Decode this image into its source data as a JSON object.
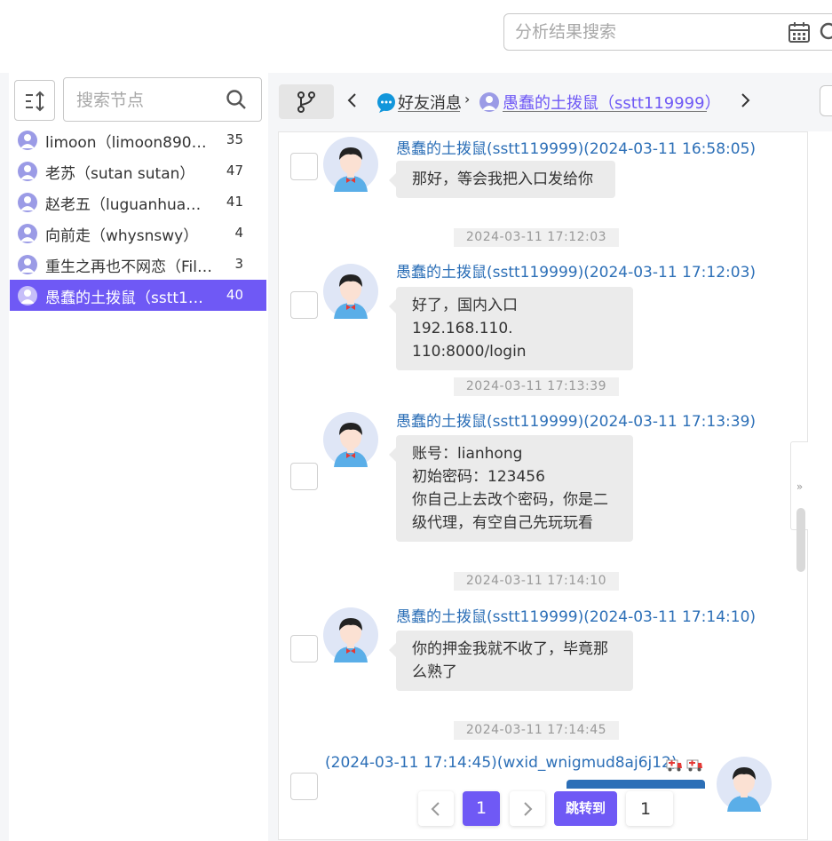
{
  "top_search": {
    "placeholder": "分析结果搜索"
  },
  "sidebar": {
    "search_placeholder": "搜索节点",
    "friends": [
      {
        "name": "limoon（limoon890…",
        "count": "35"
      },
      {
        "name": "老苏（sutan sutan）",
        "count": "47"
      },
      {
        "name": "赵老五（luguanhua…",
        "count": "41"
      },
      {
        "name": "向前走（whysnswy）",
        "count": "4"
      },
      {
        "name": "重生之再也不网恋（Fil…",
        "count": "3"
      },
      {
        "name": "愚蠢的土拨鼠（sstt1…",
        "count": "40",
        "active": true
      }
    ]
  },
  "breadcrumb": {
    "item1": "好友消息",
    "separator": "›",
    "item2": "愚蠢的土拨鼠（sstt119999）"
  },
  "messages": [
    {
      "meta": "愚蠢的土拨鼠(sstt119999)(2024-03-11 16:58:05)",
      "lines": [
        "那好，等会我把入口发给你"
      ]
    },
    {
      "timestamp": "2024-03-11 17:12:03",
      "meta": "愚蠢的土拨鼠(sstt119999)(2024-03-11 17:12:03)",
      "lines": [
        "好了，国内入口192.168.110.",
        "110:8000/login"
      ]
    },
    {
      "timestamp": "2024-03-11 17:13:39",
      "meta": "愚蠢的土拨鼠(sstt119999)(2024-03-11 17:13:39)",
      "lines": [
        "账号：lianhong",
        "初始密码：123456",
        "你自己上去改个密码，你是二",
        "级代理，有空自己先玩玩看"
      ]
    },
    {
      "timestamp": "2024-03-11 17:14:10",
      "meta": "愚蠢的土拨鼠(sstt119999)(2024-03-11 17:14:10)",
      "lines": [
        "你的押金我就不收了，毕竟那",
        "么熟了"
      ]
    },
    {
      "timestamp": "2024-03-11 17:14:45",
      "meta": "(2024-03-11 17:14:45)(wxid_wnigmud8aj6j12)"
    }
  ],
  "pagination": {
    "current": "1",
    "jump_label": "跳转到",
    "jump_value": "1"
  },
  "colors": {
    "accent": "#6f59f5",
    "meta_blue": "#2c6fb7",
    "bubble": "#ebebeb"
  },
  "icons": [
    "calendar-icon",
    "search-icon",
    "sort-icon",
    "branch-icon",
    "chevron-left-icon",
    "chevron-right-icon",
    "chat-bubble-icon",
    "user-avatar-icon",
    "ambulance-icon",
    "double-chevron-right-icon"
  ]
}
